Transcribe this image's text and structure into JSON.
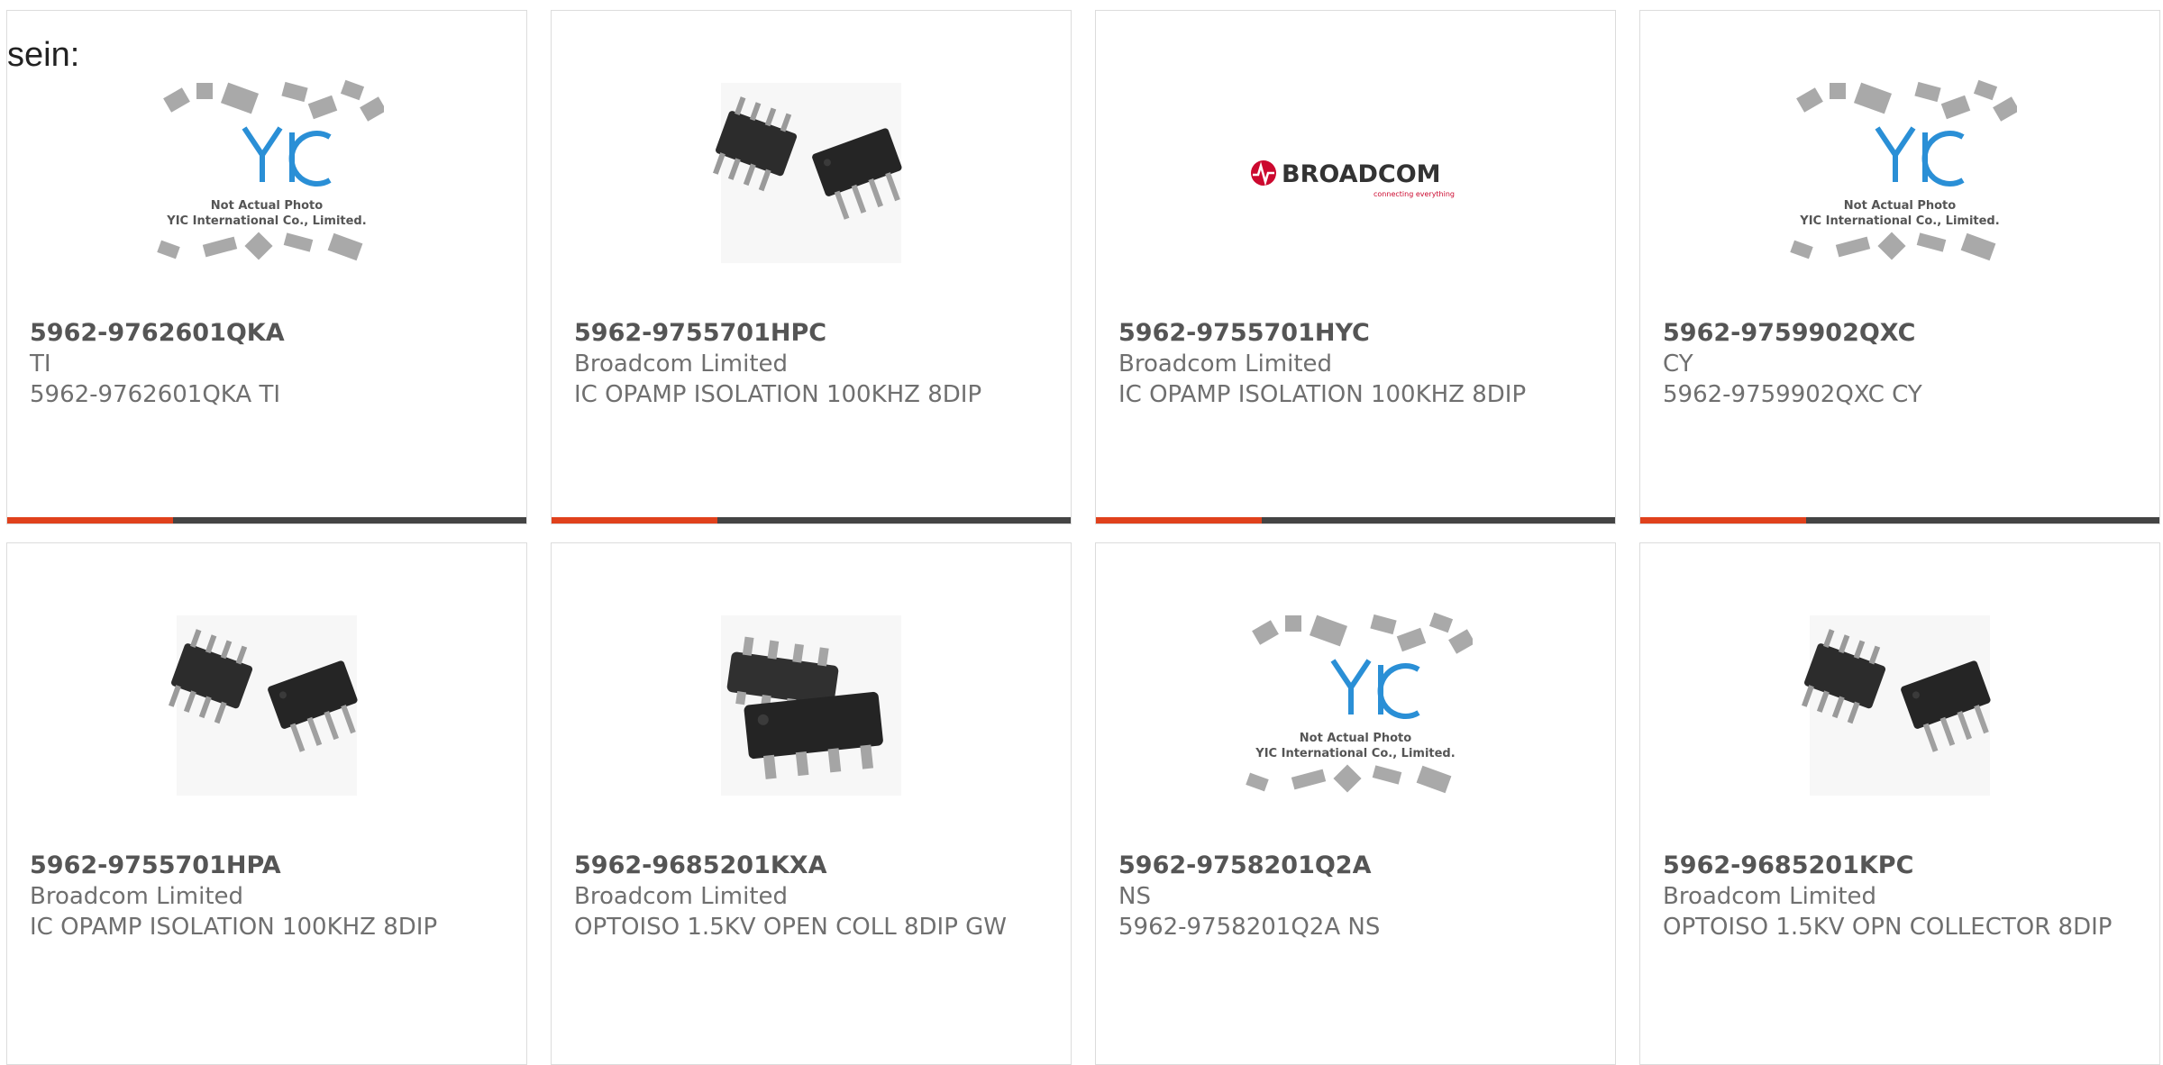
{
  "intro_text": "sein:",
  "accent_color": "#e0411c",
  "products": [
    {
      "part": "5962-9762601QKA",
      "manufacturer": "TI",
      "description": "5962-9762601QKA TI",
      "image": "yic-placeholder-photo",
      "placeholder": {
        "brand": "YIC",
        "line1": "Not Actual Photo",
        "line2": "YIC International Co., Limited."
      }
    },
    {
      "part": "5962-9755701HPC",
      "manufacturer": "Broadcom Limited",
      "description": "IC OPAMP ISOLATION 100KHZ 8DIP",
      "image": "dip8-chip-photo"
    },
    {
      "part": "5962-9755701HYC",
      "manufacturer": "Broadcom Limited",
      "description": "IC OPAMP ISOLATION 100KHZ 8DIP",
      "image": "broadcom-logo",
      "logo": {
        "name": "BROADCOM",
        "tagline": "connecting everything"
      }
    },
    {
      "part": "5962-9759902QXC",
      "manufacturer": "CY",
      "description": "5962-9759902QXC CY",
      "image": "yic-placeholder-photo",
      "placeholder": {
        "brand": "YIC",
        "line1": "Not Actual Photo",
        "line2": "YIC International Co., Limited."
      }
    },
    {
      "part": "5962-9755701HPA",
      "manufacturer": "Broadcom Limited",
      "description": "IC OPAMP ISOLATION 100KHZ 8DIP",
      "image": "dip8-chip-photo"
    },
    {
      "part": "5962-9685201KXA",
      "manufacturer": "Broadcom Limited",
      "description": "OPTOISO 1.5KV OPEN COLL 8DIP GW",
      "image": "smd8-chip-photo"
    },
    {
      "part": "5962-9758201Q2A",
      "manufacturer": "NS",
      "description": "5962-9758201Q2A NS",
      "image": "yic-placeholder-photo",
      "placeholder": {
        "brand": "YIC",
        "line1": "Not Actual Photo",
        "line2": "YIC International Co., Limited."
      }
    },
    {
      "part": "5962-9685201KPC",
      "manufacturer": "Broadcom Limited",
      "description": "OPTOISO 1.5KV OPN COLLECTOR 8DIP",
      "image": "dip8-chip-photo"
    }
  ]
}
